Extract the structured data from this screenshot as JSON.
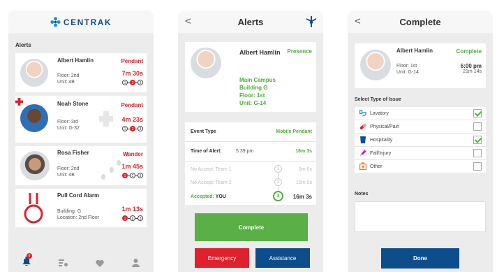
{
  "screen1": {
    "logo_text": "CENTRAK",
    "alerts_label": "Alerts",
    "badge_count": "6",
    "alerts": [
      {
        "name": "Albert Hamlin",
        "line1": "Floor: 2nd",
        "line2": "Unit: 4B",
        "type": "Pendant",
        "time": "7m 30s",
        "active_step": 2
      },
      {
        "name": "Noah Stone",
        "line1": "Floor: 3rd",
        "line2": "Unit: G-32",
        "type": "Pendant",
        "time": "4m 23s",
        "active_step": 2
      },
      {
        "name": "Rosa Fisher",
        "line1": "Floor: 2nd",
        "line2": "Unit: 4B",
        "type": "Wander",
        "time": "1m 45s",
        "active_step": 1
      },
      {
        "name": "Pull Cord Alarm",
        "line1": "Building: G",
        "line2": "Location: 2nd Floor",
        "type": "",
        "time": "1m 13s",
        "active_step": 1
      }
    ]
  },
  "screen2": {
    "title": "Alerts",
    "back": "<",
    "name": "Albert Hamlin",
    "tag": "Presence",
    "location": [
      "Main Campus",
      "Building G",
      "Floor: 1st",
      "Unit: G-14"
    ],
    "event_type_label": "Event Type",
    "event_type_value": "Mobile Pendant",
    "time_of_alert_label": "Time of Alert:",
    "time_of_alert_value": "5:39 pm",
    "time_of_alert_elapsed": "16m 3s",
    "escalation": [
      {
        "label": "No Accept: Team 1",
        "num": "1",
        "time": "5m 0s"
      },
      {
        "label": "No Accept: Team 2",
        "num": "2",
        "time": "10m 0s"
      },
      {
        "label": "Accepted:",
        "who": "YOU",
        "num": "3",
        "time": "16m 3s"
      }
    ],
    "complete_label": "Complete",
    "emergency_label": "Emergency",
    "assistance_label": "Assistance"
  },
  "screen3": {
    "title": "Complete",
    "back": "<",
    "name": "Albert Hamlin",
    "line1": "Floor: 1st",
    "line2": "Unit: G-14",
    "tag": "Complete",
    "time": "6:00 pm",
    "elapsed": "21m 14s",
    "select_label": "Select Type of Issue",
    "issues": [
      {
        "label": "Lavatory",
        "checked": true,
        "icon": "toilet-icon"
      },
      {
        "label": "Physical/Pain",
        "checked": false,
        "icon": "pill-icon"
      },
      {
        "label": "Hospitality",
        "checked": true,
        "icon": "cup-icon"
      },
      {
        "label": "Fall/Injury",
        "checked": false,
        "icon": "syringe-icon"
      },
      {
        "label": "Other",
        "checked": false,
        "icon": "medkit-icon"
      }
    ],
    "notes_label": "Notes",
    "done_label": "Done"
  },
  "colors": {
    "red": "#e0202a",
    "green": "#4caf36",
    "blue": "#0e4d8c",
    "complete_button": "#5aaf46"
  }
}
